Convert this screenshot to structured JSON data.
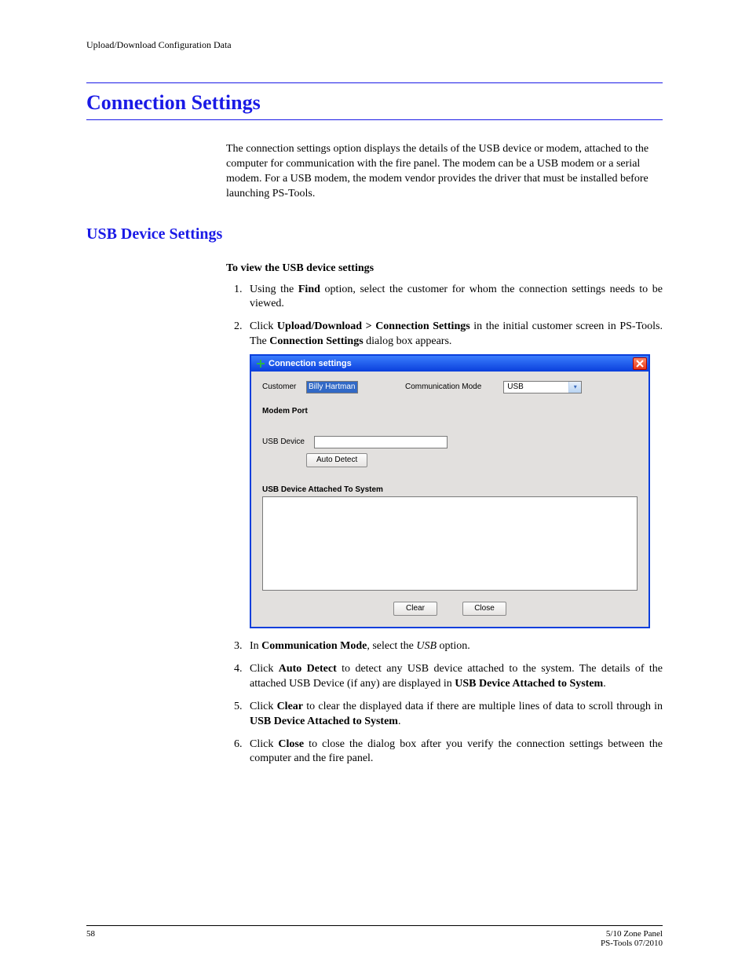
{
  "runningHead": "Upload/Download Configuration Data",
  "sectionTitle": "Connection Settings",
  "introPara": "The connection settings option displays the details of the USB device or modem, attached to the computer for communication with the fire panel. The modem can be a USB modem or a serial modem. For a USB modem, the modem vendor provides the driver that must be installed before launching PS-Tools.",
  "subsectionTitle": "USB Device Settings",
  "procHeading": "To view the USB device settings",
  "steps": {
    "s1a": "Using the ",
    "s1b": "Find",
    "s1c": " option, select the customer for whom the connection settings needs to be viewed.",
    "s2a": "Click ",
    "s2b": "Upload/Download > Connection Settings",
    "s2c": " in the initial customer screen in PS-Tools. The ",
    "s2d": "Connection Settings",
    "s2e": " dialog box appears.",
    "s3a": "In ",
    "s3b": "Communication Mode",
    "s3c": ", select the ",
    "s3d": "USB",
    "s3e": " option.",
    "s4a": "Click ",
    "s4b": "Auto Detect",
    "s4c": " to detect any USB device attached to the system. The details of the attached USB Device (if any) are displayed in ",
    "s4d": "USB Device Attached to System",
    "s4e": ".",
    "s5a": "Click ",
    "s5b": "Clear",
    "s5c": " to clear the displayed data if there are multiple lines of data to scroll through in ",
    "s5d": "USB Device Attached to System",
    "s5e": ".",
    "s6a": "Click ",
    "s6b": "Close",
    "s6c": " to close the dialog box after you verify the connection settings between the computer and the fire panel."
  },
  "dialog": {
    "title": "Connection settings",
    "customerLabel": "Customer",
    "customerValue": "Billy Hartman",
    "commModeLabel": "Communication Mode",
    "commModeValue": "USB",
    "modemPortLabel": "Modem Port",
    "usbDeviceLabel": "USB Device",
    "autoDetect": "Auto Detect",
    "attachedLabel": "USB Device Attached To System",
    "clear": "Clear",
    "close": "Close"
  },
  "footer": {
    "pageNum": "58",
    "right1": "5/10 Zone Panel",
    "right2": "PS-Tools 07/2010"
  }
}
